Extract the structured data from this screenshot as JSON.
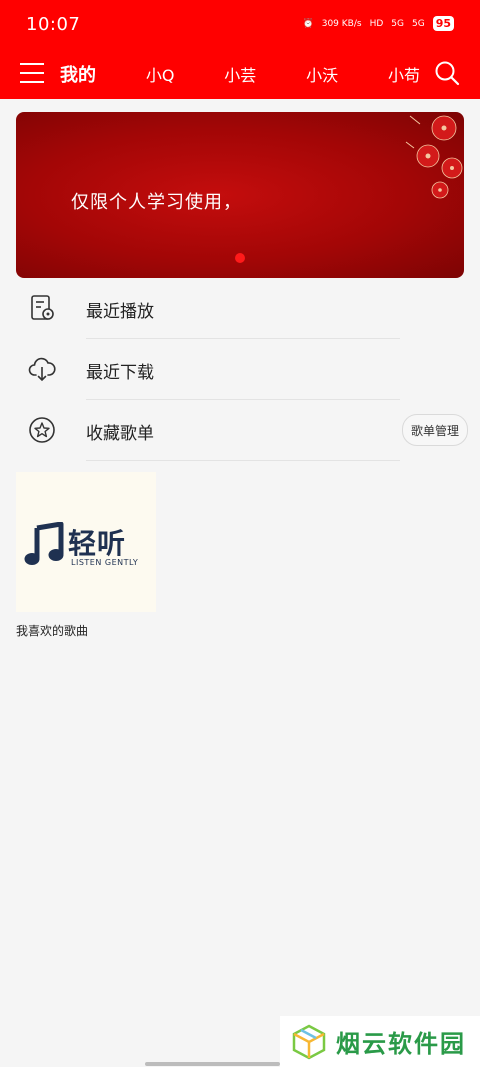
{
  "status_bar": {
    "time": "10:07",
    "network_speed": "309 KB/s",
    "signal_1": "5G",
    "signal_2": "5G",
    "battery": "95"
  },
  "header": {
    "tabs": [
      {
        "label": "我的",
        "active": true
      },
      {
        "label": "小Q",
        "active": false
      },
      {
        "label": "小芸",
        "active": false
      },
      {
        "label": "小沃",
        "active": false
      },
      {
        "label": "小苟",
        "active": false
      }
    ],
    "icons": {
      "menu": "menu-icon",
      "search": "search-icon"
    },
    "background_color": "#ff0000"
  },
  "banner": {
    "text": "仅限个人学习使用，",
    "background_color": "#a30606",
    "dot_color": "#ff1a1a"
  },
  "menu_list": {
    "items": [
      {
        "label": "最近播放",
        "icon": "recent-play-icon"
      },
      {
        "label": "最近下载",
        "icon": "cloud-download-icon"
      },
      {
        "label": "收藏歌单",
        "icon": "star-icon"
      }
    ],
    "manage_button": "歌单管理"
  },
  "playlists": [
    {
      "name": "我喜欢的歌曲",
      "cover_title": "轻听",
      "cover_subtitle": "LISTEN GENTLY"
    }
  ],
  "watermark": {
    "text": "烟云软件园",
    "color": "#2a9a48"
  }
}
